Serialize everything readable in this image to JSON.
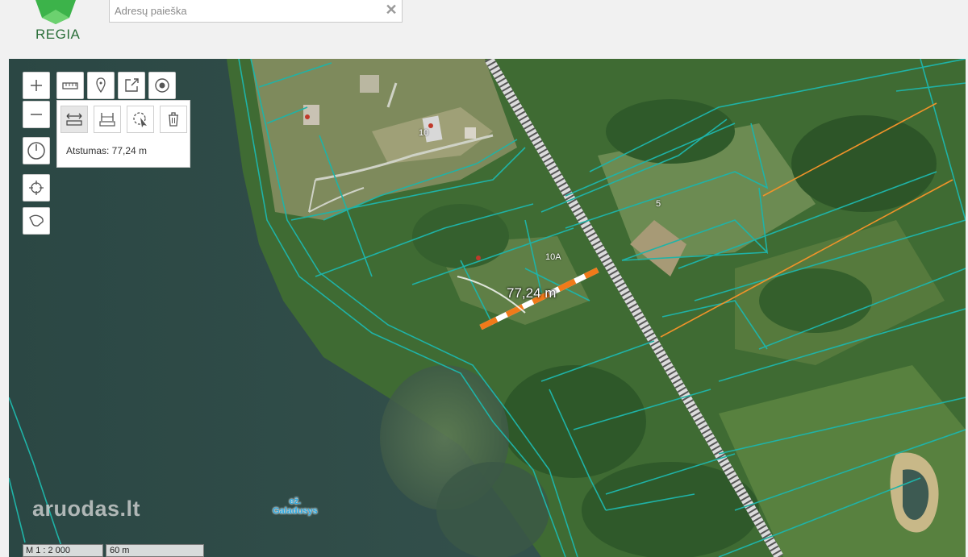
{
  "header": {
    "logo_text": "REGIA",
    "search": {
      "placeholder": "Adresų paieška",
      "value": ""
    },
    "clear_icon": "close-icon"
  },
  "toolbar": {
    "zoom_in_icon": "plus-icon",
    "zoom_out_icon": "minus-icon",
    "compass_icon": "compass-icon",
    "locate_icon": "crosshair-icon",
    "polygon_icon": "polygon-icon",
    "top_tools": [
      "ruler-icon",
      "marker-icon",
      "export-icon",
      "target-icon"
    ],
    "measure_tools": [
      "distance-icon",
      "area-icon",
      "cursor-measure-icon",
      "trash-icon"
    ],
    "distance_text": "Atstumas: 77,24 m"
  },
  "map": {
    "measure_label": "77,24 m",
    "parcel_labels": {
      "p10": "10",
      "p10a": "10A",
      "p5": "5"
    },
    "lake_label_line1": "ež.",
    "lake_label_line2": "Galadusys",
    "watermark": "aruodas.lt",
    "scale_ratio": "M 1 : 2 000",
    "scale_bar": "60 m",
    "colors": {
      "parcel_line": "#1fb3a7",
      "measure_line": "#f07a1a",
      "highlight_parcel": "#f0932a"
    }
  }
}
